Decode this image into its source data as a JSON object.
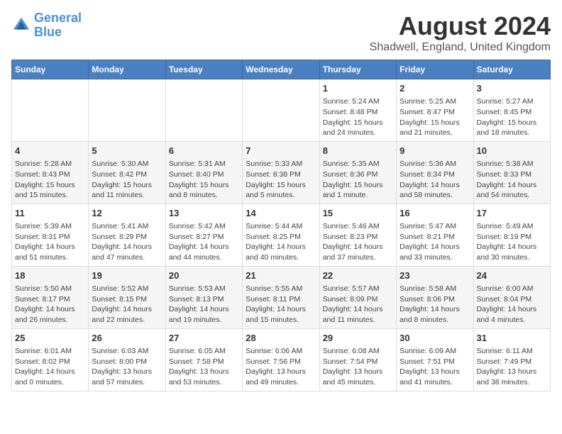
{
  "header": {
    "logo_line1": "General",
    "logo_line2": "Blue",
    "main_title": "August 2024",
    "subtitle": "Shadwell, England, United Kingdom"
  },
  "days_of_week": [
    "Sunday",
    "Monday",
    "Tuesday",
    "Wednesday",
    "Thursday",
    "Friday",
    "Saturday"
  ],
  "weeks": [
    [
      {
        "day": "",
        "info": ""
      },
      {
        "day": "",
        "info": ""
      },
      {
        "day": "",
        "info": ""
      },
      {
        "day": "",
        "info": ""
      },
      {
        "day": "1",
        "info": "Sunrise: 5:24 AM\nSunset: 8:48 PM\nDaylight: 15 hours\nand 24 minutes."
      },
      {
        "day": "2",
        "info": "Sunrise: 5:25 AM\nSunset: 8:47 PM\nDaylight: 15 hours\nand 21 minutes."
      },
      {
        "day": "3",
        "info": "Sunrise: 5:27 AM\nSunset: 8:45 PM\nDaylight: 15 hours\nand 18 minutes."
      }
    ],
    [
      {
        "day": "4",
        "info": "Sunrise: 5:28 AM\nSunset: 8:43 PM\nDaylight: 15 hours\nand 15 minutes."
      },
      {
        "day": "5",
        "info": "Sunrise: 5:30 AM\nSunset: 8:42 PM\nDaylight: 15 hours\nand 11 minutes."
      },
      {
        "day": "6",
        "info": "Sunrise: 5:31 AM\nSunset: 8:40 PM\nDaylight: 15 hours\nand 8 minutes."
      },
      {
        "day": "7",
        "info": "Sunrise: 5:33 AM\nSunset: 8:38 PM\nDaylight: 15 hours\nand 5 minutes."
      },
      {
        "day": "8",
        "info": "Sunrise: 5:35 AM\nSunset: 8:36 PM\nDaylight: 15 hours\nand 1 minute."
      },
      {
        "day": "9",
        "info": "Sunrise: 5:36 AM\nSunset: 8:34 PM\nDaylight: 14 hours\nand 58 minutes."
      },
      {
        "day": "10",
        "info": "Sunrise: 5:38 AM\nSunset: 8:33 PM\nDaylight: 14 hours\nand 54 minutes."
      }
    ],
    [
      {
        "day": "11",
        "info": "Sunrise: 5:39 AM\nSunset: 8:31 PM\nDaylight: 14 hours\nand 51 minutes."
      },
      {
        "day": "12",
        "info": "Sunrise: 5:41 AM\nSunset: 8:29 PM\nDaylight: 14 hours\nand 47 minutes."
      },
      {
        "day": "13",
        "info": "Sunrise: 5:42 AM\nSunset: 8:27 PM\nDaylight: 14 hours\nand 44 minutes."
      },
      {
        "day": "14",
        "info": "Sunrise: 5:44 AM\nSunset: 8:25 PM\nDaylight: 14 hours\nand 40 minutes."
      },
      {
        "day": "15",
        "info": "Sunrise: 5:46 AM\nSunset: 8:23 PM\nDaylight: 14 hours\nand 37 minutes."
      },
      {
        "day": "16",
        "info": "Sunrise: 5:47 AM\nSunset: 8:21 PM\nDaylight: 14 hours\nand 33 minutes."
      },
      {
        "day": "17",
        "info": "Sunrise: 5:49 AM\nSunset: 8:19 PM\nDaylight: 14 hours\nand 30 minutes."
      }
    ],
    [
      {
        "day": "18",
        "info": "Sunrise: 5:50 AM\nSunset: 8:17 PM\nDaylight: 14 hours\nand 26 minutes."
      },
      {
        "day": "19",
        "info": "Sunrise: 5:52 AM\nSunset: 8:15 PM\nDaylight: 14 hours\nand 22 minutes."
      },
      {
        "day": "20",
        "info": "Sunrise: 5:53 AM\nSunset: 8:13 PM\nDaylight: 14 hours\nand 19 minutes."
      },
      {
        "day": "21",
        "info": "Sunrise: 5:55 AM\nSunset: 8:11 PM\nDaylight: 14 hours\nand 15 minutes."
      },
      {
        "day": "22",
        "info": "Sunrise: 5:57 AM\nSunset: 8:09 PM\nDaylight: 14 hours\nand 11 minutes."
      },
      {
        "day": "23",
        "info": "Sunrise: 5:58 AM\nSunset: 8:06 PM\nDaylight: 14 hours\nand 8 minutes."
      },
      {
        "day": "24",
        "info": "Sunrise: 6:00 AM\nSunset: 8:04 PM\nDaylight: 14 hours\nand 4 minutes."
      }
    ],
    [
      {
        "day": "25",
        "info": "Sunrise: 6:01 AM\nSunset: 8:02 PM\nDaylight: 14 hours\nand 0 minutes."
      },
      {
        "day": "26",
        "info": "Sunrise: 6:03 AM\nSunset: 8:00 PM\nDaylight: 13 hours\nand 57 minutes."
      },
      {
        "day": "27",
        "info": "Sunrise: 6:05 AM\nSunset: 7:58 PM\nDaylight: 13 hours\nand 53 minutes."
      },
      {
        "day": "28",
        "info": "Sunrise: 6:06 AM\nSunset: 7:56 PM\nDaylight: 13 hours\nand 49 minutes."
      },
      {
        "day": "29",
        "info": "Sunrise: 6:08 AM\nSunset: 7:54 PM\nDaylight: 13 hours\nand 45 minutes."
      },
      {
        "day": "30",
        "info": "Sunrise: 6:09 AM\nSunset: 7:51 PM\nDaylight: 13 hours\nand 41 minutes."
      },
      {
        "day": "31",
        "info": "Sunrise: 6:11 AM\nSunset: 7:49 PM\nDaylight: 13 hours\nand 38 minutes."
      }
    ]
  ]
}
